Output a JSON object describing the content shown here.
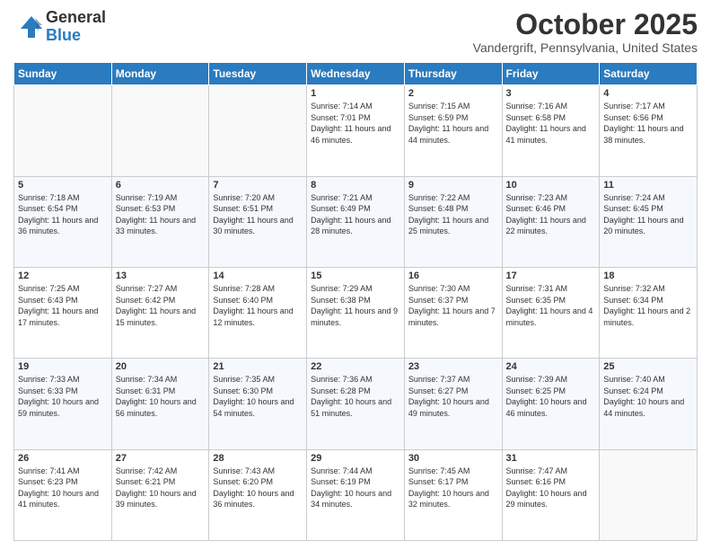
{
  "logo": {
    "general": "General",
    "blue": "Blue"
  },
  "header": {
    "month": "October 2025",
    "location": "Vandergrift, Pennsylvania, United States"
  },
  "weekdays": [
    "Sunday",
    "Monday",
    "Tuesday",
    "Wednesday",
    "Thursday",
    "Friday",
    "Saturday"
  ],
  "weeks": [
    [
      {
        "day": "",
        "info": ""
      },
      {
        "day": "",
        "info": ""
      },
      {
        "day": "",
        "info": ""
      },
      {
        "day": "1",
        "info": "Sunrise: 7:14 AM\nSunset: 7:01 PM\nDaylight: 11 hours\nand 46 minutes."
      },
      {
        "day": "2",
        "info": "Sunrise: 7:15 AM\nSunset: 6:59 PM\nDaylight: 11 hours\nand 44 minutes."
      },
      {
        "day": "3",
        "info": "Sunrise: 7:16 AM\nSunset: 6:58 PM\nDaylight: 11 hours\nand 41 minutes."
      },
      {
        "day": "4",
        "info": "Sunrise: 7:17 AM\nSunset: 6:56 PM\nDaylight: 11 hours\nand 38 minutes."
      }
    ],
    [
      {
        "day": "5",
        "info": "Sunrise: 7:18 AM\nSunset: 6:54 PM\nDaylight: 11 hours\nand 36 minutes."
      },
      {
        "day": "6",
        "info": "Sunrise: 7:19 AM\nSunset: 6:53 PM\nDaylight: 11 hours\nand 33 minutes."
      },
      {
        "day": "7",
        "info": "Sunrise: 7:20 AM\nSunset: 6:51 PM\nDaylight: 11 hours\nand 30 minutes."
      },
      {
        "day": "8",
        "info": "Sunrise: 7:21 AM\nSunset: 6:49 PM\nDaylight: 11 hours\nand 28 minutes."
      },
      {
        "day": "9",
        "info": "Sunrise: 7:22 AM\nSunset: 6:48 PM\nDaylight: 11 hours\nand 25 minutes."
      },
      {
        "day": "10",
        "info": "Sunrise: 7:23 AM\nSunset: 6:46 PM\nDaylight: 11 hours\nand 22 minutes."
      },
      {
        "day": "11",
        "info": "Sunrise: 7:24 AM\nSunset: 6:45 PM\nDaylight: 11 hours\nand 20 minutes."
      }
    ],
    [
      {
        "day": "12",
        "info": "Sunrise: 7:25 AM\nSunset: 6:43 PM\nDaylight: 11 hours\nand 17 minutes."
      },
      {
        "day": "13",
        "info": "Sunrise: 7:27 AM\nSunset: 6:42 PM\nDaylight: 11 hours\nand 15 minutes."
      },
      {
        "day": "14",
        "info": "Sunrise: 7:28 AM\nSunset: 6:40 PM\nDaylight: 11 hours\nand 12 minutes."
      },
      {
        "day": "15",
        "info": "Sunrise: 7:29 AM\nSunset: 6:38 PM\nDaylight: 11 hours\nand 9 minutes."
      },
      {
        "day": "16",
        "info": "Sunrise: 7:30 AM\nSunset: 6:37 PM\nDaylight: 11 hours\nand 7 minutes."
      },
      {
        "day": "17",
        "info": "Sunrise: 7:31 AM\nSunset: 6:35 PM\nDaylight: 11 hours\nand 4 minutes."
      },
      {
        "day": "18",
        "info": "Sunrise: 7:32 AM\nSunset: 6:34 PM\nDaylight: 11 hours\nand 2 minutes."
      }
    ],
    [
      {
        "day": "19",
        "info": "Sunrise: 7:33 AM\nSunset: 6:33 PM\nDaylight: 10 hours\nand 59 minutes."
      },
      {
        "day": "20",
        "info": "Sunrise: 7:34 AM\nSunset: 6:31 PM\nDaylight: 10 hours\nand 56 minutes."
      },
      {
        "day": "21",
        "info": "Sunrise: 7:35 AM\nSunset: 6:30 PM\nDaylight: 10 hours\nand 54 minutes."
      },
      {
        "day": "22",
        "info": "Sunrise: 7:36 AM\nSunset: 6:28 PM\nDaylight: 10 hours\nand 51 minutes."
      },
      {
        "day": "23",
        "info": "Sunrise: 7:37 AM\nSunset: 6:27 PM\nDaylight: 10 hours\nand 49 minutes."
      },
      {
        "day": "24",
        "info": "Sunrise: 7:39 AM\nSunset: 6:25 PM\nDaylight: 10 hours\nand 46 minutes."
      },
      {
        "day": "25",
        "info": "Sunrise: 7:40 AM\nSunset: 6:24 PM\nDaylight: 10 hours\nand 44 minutes."
      }
    ],
    [
      {
        "day": "26",
        "info": "Sunrise: 7:41 AM\nSunset: 6:23 PM\nDaylight: 10 hours\nand 41 minutes."
      },
      {
        "day": "27",
        "info": "Sunrise: 7:42 AM\nSunset: 6:21 PM\nDaylight: 10 hours\nand 39 minutes."
      },
      {
        "day": "28",
        "info": "Sunrise: 7:43 AM\nSunset: 6:20 PM\nDaylight: 10 hours\nand 36 minutes."
      },
      {
        "day": "29",
        "info": "Sunrise: 7:44 AM\nSunset: 6:19 PM\nDaylight: 10 hours\nand 34 minutes."
      },
      {
        "day": "30",
        "info": "Sunrise: 7:45 AM\nSunset: 6:17 PM\nDaylight: 10 hours\nand 32 minutes."
      },
      {
        "day": "31",
        "info": "Sunrise: 7:47 AM\nSunset: 6:16 PM\nDaylight: 10 hours\nand 29 minutes."
      },
      {
        "day": "",
        "info": ""
      }
    ]
  ]
}
